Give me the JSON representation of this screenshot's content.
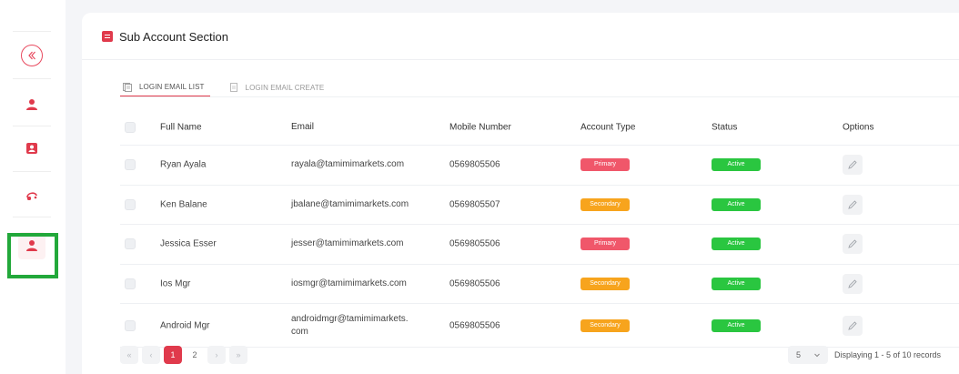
{
  "card": {
    "title": "Sub Account Section"
  },
  "tabs": [
    {
      "label": "LOGIN EMAIL LIST",
      "active": true
    },
    {
      "label": "LOGIN EMAIL CREATE",
      "active": false
    }
  ],
  "table": {
    "columns": [
      "Full Name",
      "Email",
      "Mobile Number",
      "Account Type",
      "Status",
      "Options"
    ],
    "rows": [
      {
        "name": "Ryan Ayala",
        "email": "rayala@tamimimarkets.com",
        "mobile": "0569805506",
        "type": "Primary",
        "status": "Active"
      },
      {
        "name": "Ken Balane",
        "email": "jbalane@tamimimarkets.com",
        "mobile": "0569805507",
        "type": "Secondary",
        "status": "Active"
      },
      {
        "name": "Jessica Esser",
        "email": "jesser@tamimimarkets.com",
        "mobile": "0569805506",
        "type": "Primary",
        "status": "Active"
      },
      {
        "name": "Ios Mgr",
        "email": "iosmgr@tamimimarkets.com",
        "mobile": "0569805506",
        "type": "Secondary",
        "status": "Active"
      },
      {
        "name": "Android Mgr",
        "email": "androidmgr@tamimimarkets.\ncom",
        "mobile": "0569805506",
        "type": "Secondary",
        "status": "Active"
      }
    ]
  },
  "pagination": {
    "first": "«",
    "prev": "‹",
    "pages": [
      "1",
      "2"
    ],
    "current": "1",
    "next": "›",
    "last": "»",
    "page_size": "5",
    "records_text": "Displaying 1 - 5 of 10 records"
  },
  "colors": {
    "accent": "#e03a4c",
    "primary_badge": "#f0576a",
    "secondary_badge": "#f7a41d",
    "active_badge": "#2ac640",
    "highlight": "#22a83a"
  },
  "icons": {
    "collapse": "chevron-double-left-icon",
    "users": "user-icon",
    "contact": "contact-card-icon",
    "support": "headset-icon",
    "sub_account": "user-account-icon",
    "edit": "pencil-icon"
  }
}
